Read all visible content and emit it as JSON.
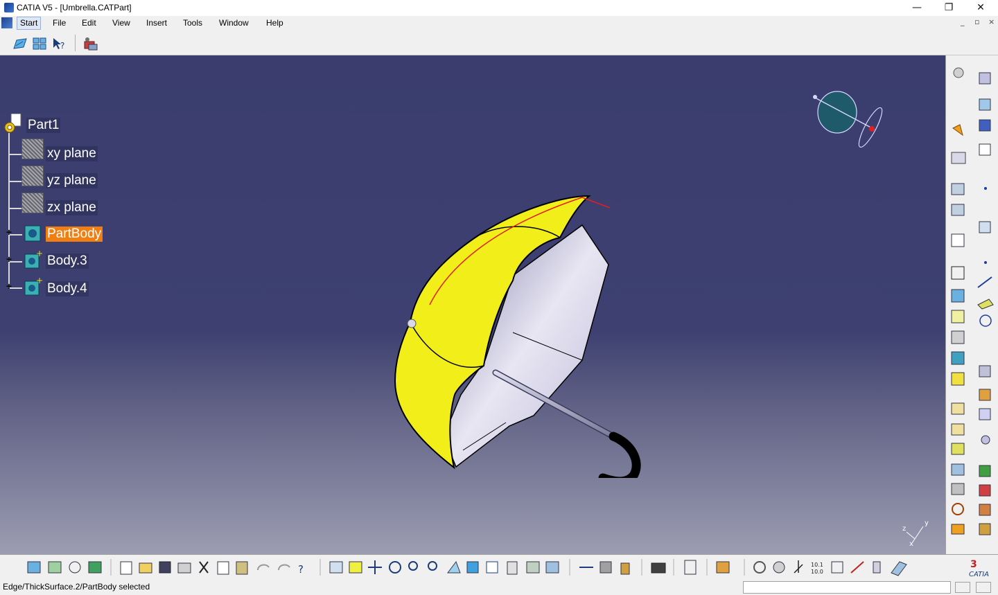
{
  "window": {
    "title": "CATIA V5 - [Umbrella.CATPart]",
    "minimize": "—",
    "restore": "❐",
    "close": "✕"
  },
  "menu": {
    "items": [
      "Start",
      "File",
      "Edit",
      "View",
      "Insert",
      "Tools",
      "Window",
      "Help"
    ],
    "active": "Start"
  },
  "tree": {
    "root": "Part1",
    "items": [
      {
        "label": "xy plane",
        "type": "plane"
      },
      {
        "label": "yz plane",
        "type": "plane"
      },
      {
        "label": "zx plane",
        "type": "plane"
      },
      {
        "label": "PartBody",
        "type": "body",
        "selected": true
      },
      {
        "label": "Body.3",
        "type": "body"
      },
      {
        "label": "Body.4",
        "type": "body"
      }
    ]
  },
  "status": {
    "message": "Edge/ThickSurface.2/PartBody selected"
  },
  "brand": {
    "logo_text": "CATIA"
  },
  "colors": {
    "viewport_top": "#3a3d6d",
    "viewport_bottom": "#9c9cb2",
    "selection": "#f07e10",
    "umbrella": "#f2ee1a"
  },
  "icons": {
    "top_toolbar": [
      "sketch-icon",
      "grid-icon",
      "whats-this-icon",
      "catalog-icon"
    ],
    "axis_label": "x y z"
  }
}
